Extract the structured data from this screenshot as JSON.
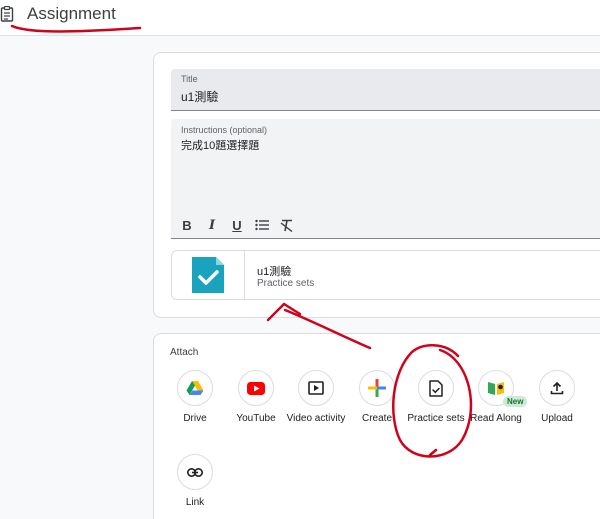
{
  "header": {
    "title": "Assignment"
  },
  "form": {
    "title_label": "Title",
    "title_value": "u1測驗",
    "instructions_label": "Instructions (optional)",
    "instructions_value": "完成10題選擇題"
  },
  "format_bar": {
    "bold": "B",
    "italic": "I",
    "underline": "U"
  },
  "attachment": {
    "name": "u1測驗",
    "type": "Practice sets"
  },
  "attach": {
    "label": "Attach",
    "tools": [
      {
        "label": "Drive"
      },
      {
        "label": "YouTube"
      },
      {
        "label": "Video activity"
      },
      {
        "label": "Create"
      },
      {
        "label": "Practice sets"
      },
      {
        "label": "Read Along",
        "badge": "New"
      },
      {
        "label": "Upload"
      },
      {
        "label": "Link"
      }
    ]
  },
  "colors": {
    "practice_sets_teal": "#1aa3bd",
    "annotation_red": "#d0021b",
    "youtube_red": "#ff0000"
  }
}
